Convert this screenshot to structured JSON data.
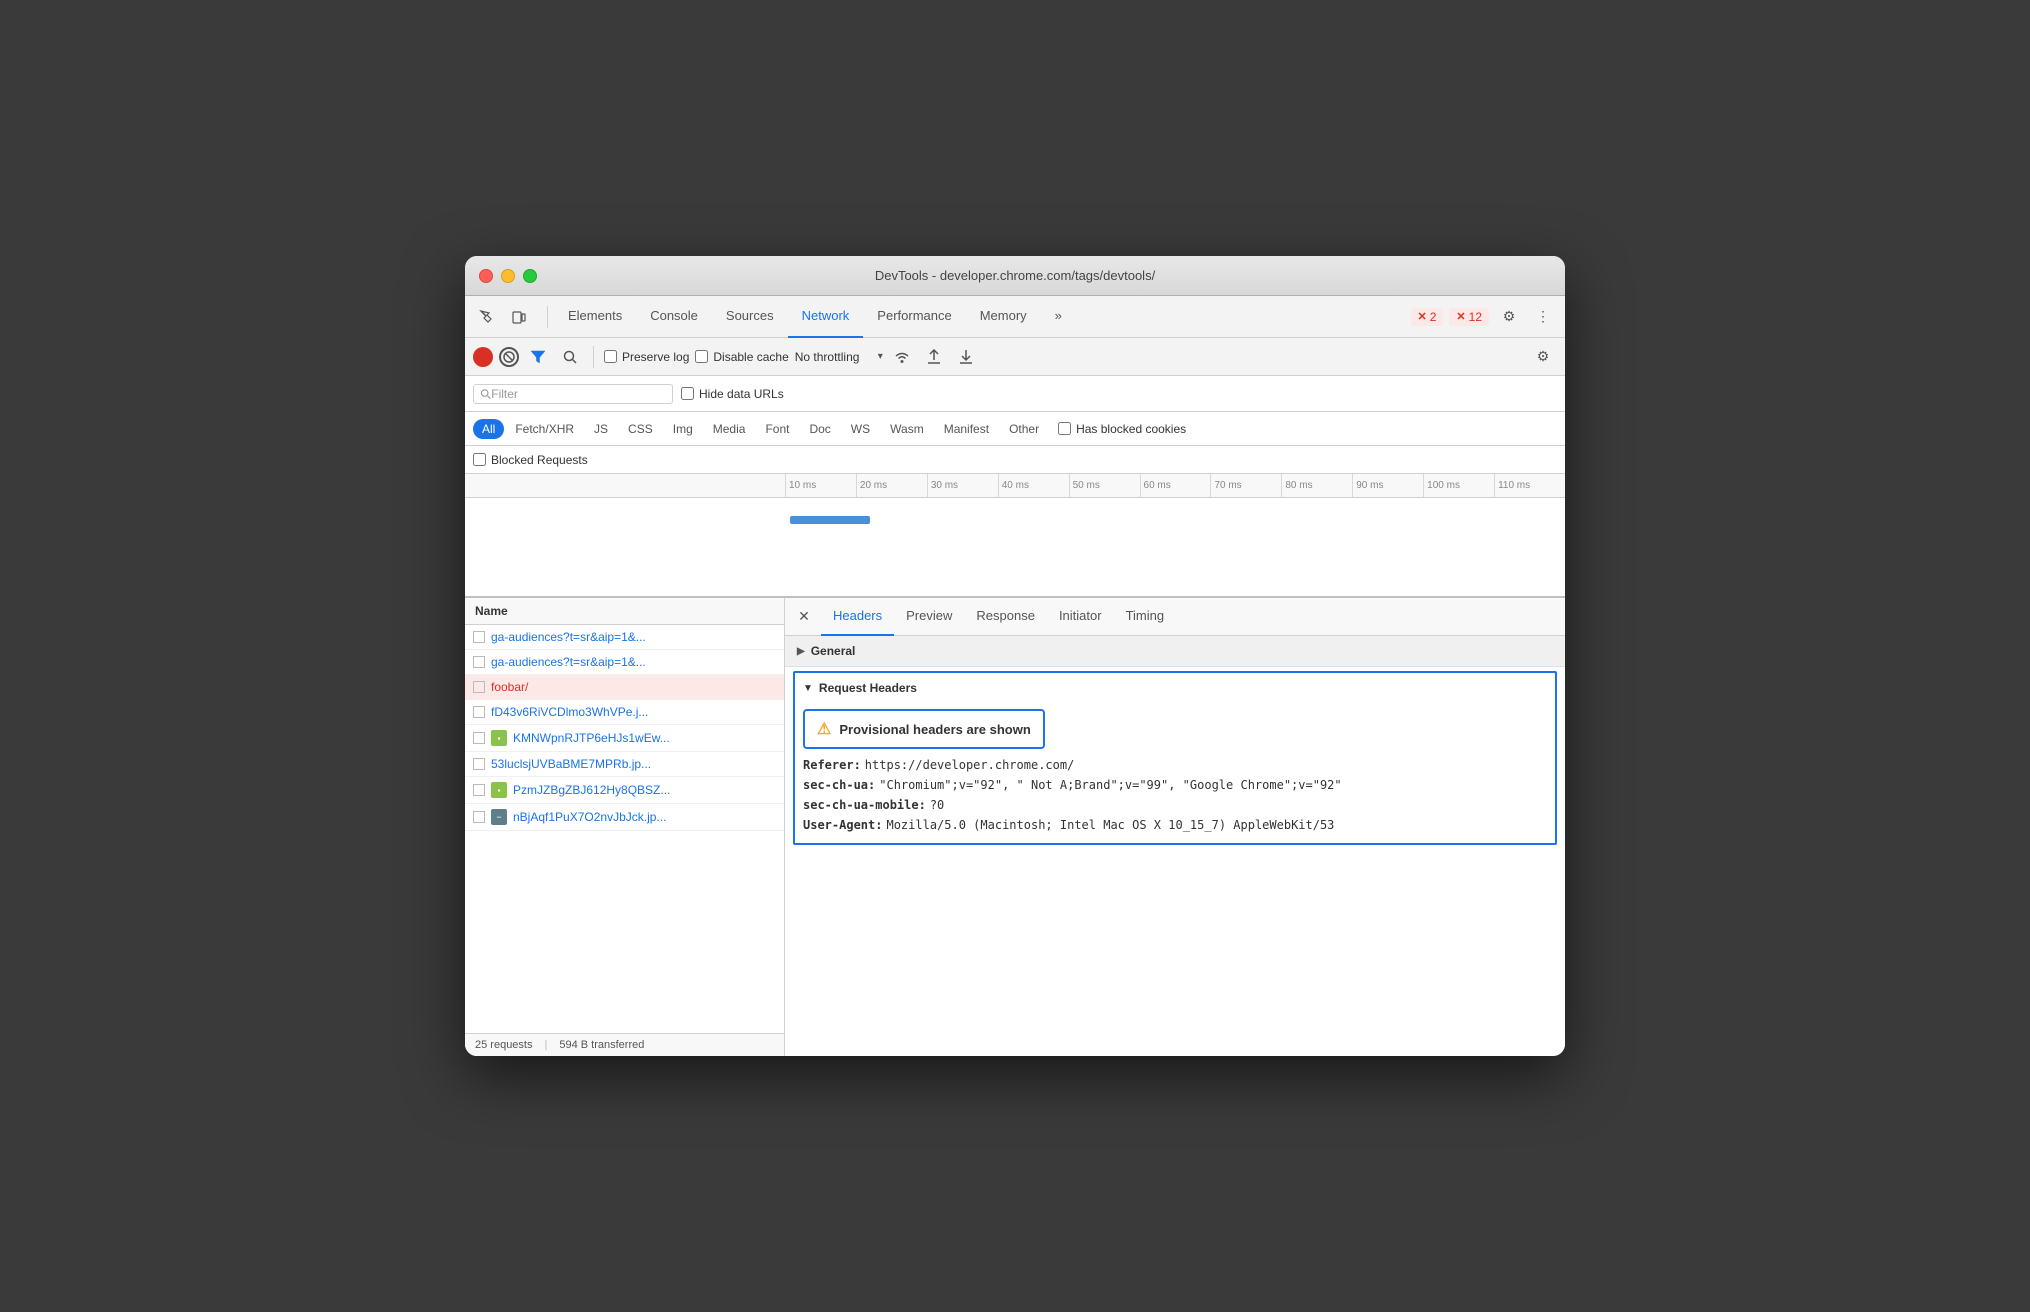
{
  "titlebar": {
    "title": "DevTools - developer.chrome.com/tags/devtools/"
  },
  "tabs": {
    "items": [
      {
        "id": "elements",
        "label": "Elements",
        "active": false
      },
      {
        "id": "console",
        "label": "Console",
        "active": false
      },
      {
        "id": "sources",
        "label": "Sources",
        "active": false
      },
      {
        "id": "network",
        "label": "Network",
        "active": true
      },
      {
        "id": "performance",
        "label": "Performance",
        "active": false
      },
      {
        "id": "memory",
        "label": "Memory",
        "active": false
      }
    ],
    "more": "»",
    "error_count": "2",
    "warning_count": "12"
  },
  "network_toolbar": {
    "preserve_log_label": "Preserve log",
    "disable_cache_label": "Disable cache",
    "throttling_label": "No throttling"
  },
  "filter_bar": {
    "placeholder": "Filter",
    "hide_data_urls_label": "Hide data URLs"
  },
  "type_filters": {
    "all": "All",
    "types": [
      "Fetch/XHR",
      "JS",
      "CSS",
      "Img",
      "Media",
      "Font",
      "Doc",
      "WS",
      "Wasm",
      "Manifest",
      "Other"
    ],
    "has_blocked_cookies": "Has blocked cookies",
    "blocked_requests": "Blocked Requests"
  },
  "ruler": {
    "ticks": [
      "10 ms",
      "20 ms",
      "30 ms",
      "40 ms",
      "50 ms",
      "60 ms",
      "70 ms",
      "80 ms",
      "90 ms",
      "100 ms",
      "110 ms"
    ]
  },
  "requests": {
    "header": "Name",
    "items": [
      {
        "id": 1,
        "name": "ga-audiences?t=sr&aip=1&...",
        "type": "doc",
        "error": false
      },
      {
        "id": 2,
        "name": "ga-audiences?t=sr&aip=1&...",
        "type": "doc",
        "error": false
      },
      {
        "id": 3,
        "name": "foobar/",
        "type": "doc",
        "error": true,
        "selected": true
      },
      {
        "id": 4,
        "name": "fD43v6RiVCDlmo3WhVPe.j...",
        "type": "js",
        "error": false
      },
      {
        "id": 5,
        "name": "KMNWpnRJTP6eHJs1wEw...",
        "type": "img",
        "error": false
      },
      {
        "id": 6,
        "name": "53luclsjUVBaBME7MPRb.jp...",
        "type": "img",
        "error": false
      },
      {
        "id": 7,
        "name": "PzmJZBgZBJ612Hy8QBSZ...",
        "type": "img",
        "error": false
      },
      {
        "id": 8,
        "name": "nBjAqf1PuX7O2nvJbJck.jp...",
        "type": "img",
        "error": false
      }
    ],
    "status": {
      "requests_count": "25 requests",
      "transferred": "594 B transferred"
    }
  },
  "detail_panel": {
    "tabs": [
      "Headers",
      "Preview",
      "Response",
      "Initiator",
      "Timing"
    ],
    "active_tab": "Headers",
    "sections": {
      "general": {
        "title": "General",
        "expanded": false
      },
      "request_headers": {
        "title": "Request Headers",
        "expanded": true,
        "warning": "Provisional headers are shown",
        "headers": [
          {
            "key": "Referer:",
            "value": "https://developer.chrome.com/"
          },
          {
            "key": "sec-ch-ua:",
            "value": "\"Chromium\";v=\"92\", \" Not A;Brand\";v=\"99\", \"Google Chrome\";v=\"92\""
          },
          {
            "key": "sec-ch-ua-mobile:",
            "value": "?0"
          },
          {
            "key": "User-Agent:",
            "value": "Mozilla/5.0 (Macintosh; Intel Mac OS X 10_15_7) AppleWebKit/53"
          }
        ]
      }
    }
  }
}
